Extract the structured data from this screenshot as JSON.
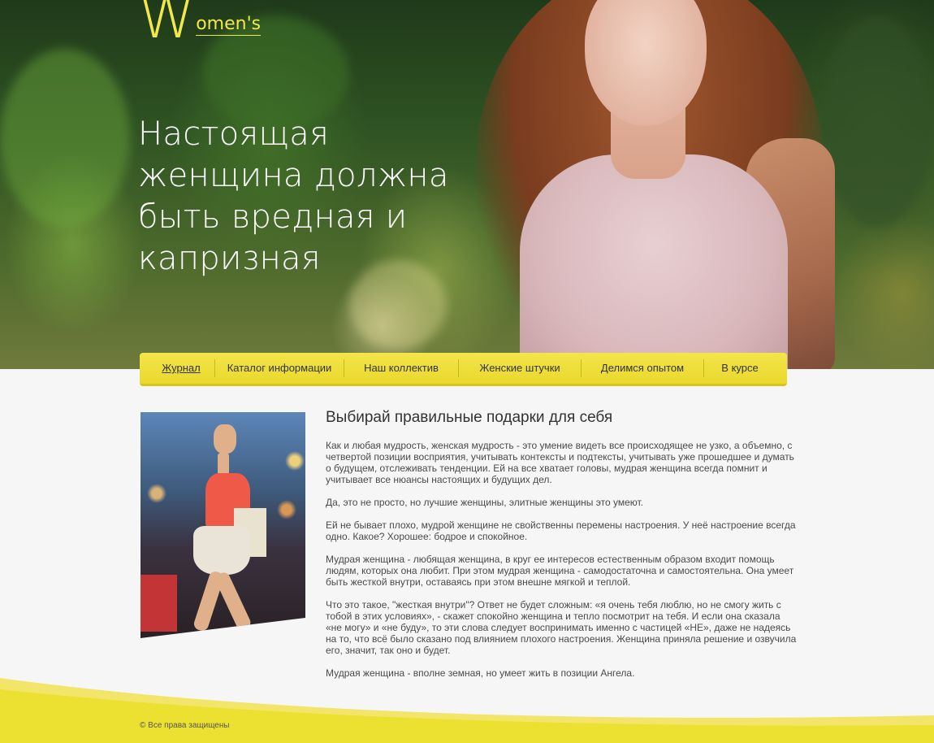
{
  "logo": {
    "initial": "W",
    "rest": "omen's"
  },
  "hero": {
    "headline": "Настоящая женщина должна быть вредная и капризная"
  },
  "nav": {
    "items": [
      {
        "label": "Журнал",
        "active": true
      },
      {
        "label": "Каталог информации"
      },
      {
        "label": "Наш коллектив"
      },
      {
        "label": "Женские штучки"
      },
      {
        "label": "Делимся опытом"
      },
      {
        "label": "В курсе"
      }
    ]
  },
  "article": {
    "title": "Выбирай правильные подарки для себя",
    "paragraphs": [
      "Как и любая мудрость, женская мудрость - это умение видеть все происходящее не узко, а объемно, с четвертой позиции восприятия, учитывать контексты и подтексты, учитывать уже прошедшее и думать о будущем, отслеживать тенденции. Ей на все хватает головы, мудрая женщина всегда помнит и учитывает все нюансы настоящих и будущих дел.",
      "Да, это не просто, но лучшие женщины, элитные женщины это умеют.",
      "Ей не бывает плохо, мудрой женщине не свойственны перемены настроения. У неё настроение всегда одно. Какое? Хорошее: бодрое и спокойное.",
      "Мудрая женщина - любящая женщина, в круг ее интересов естественным образом входит помощь людям, которых она любит. При этом мудрая женщина - самодостаточна и самостоятельна. Она умеет быть жесткой внутри, оставаясь при этом внешне мягкой и теплой.",
      "Что это такое, \"жесткая внутри\"? Ответ не будет сложным: «я очень тебя люблю, но не смогу жить с тобой в этих условиях», - скажет спокойно женщина и тепло посмотрит на тебя. И если она сказала «не могу» и «не буду», то эти слова следует воспринимать именно с частицей «НЕ», даже не надеясь на то, что всё было сказано под влиянием плохого настроения. Женщина приняла решение и озвучила его, значит, так оно и будет.",
      "Мудрая женщина - вполне земная, но умеет жить в позиции Ангела."
    ]
  },
  "footer": {
    "copyright": "© Все права защищены"
  },
  "colors": {
    "accent": "#f3e84a",
    "nav_bg": "#ece02f",
    "text": "#4a4a4a"
  }
}
